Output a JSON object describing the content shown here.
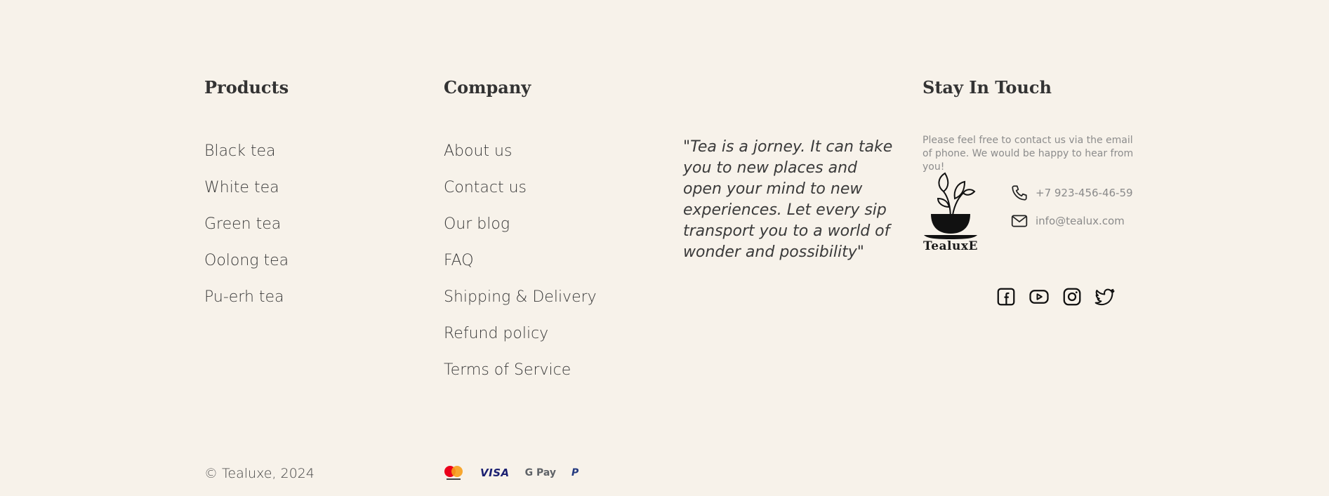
{
  "products": {
    "title": "Products",
    "items": [
      "Black tea",
      "White tea",
      "Green tea",
      "Oolong tea",
      "Pu-erh tea"
    ]
  },
  "company": {
    "title": "Company",
    "items": [
      "About us",
      "Contact us",
      "Our blog",
      "FAQ",
      "Shipping & Delivery",
      "Refund policy",
      "Terms of Service"
    ]
  },
  "quote": "\"Tea is a jorney. It can take you to new places and open your mind to new experiences. Let every sip transport you to a world of wonder and possibility\"",
  "touch": {
    "title": "Stay In Touch",
    "text": "Please feel free to contact us via the email of phone. We would be happy to hear from you!",
    "logo_text": "TealuxE",
    "phone": "+7 923-456-46-59",
    "email": "info@tealux.com",
    "social": [
      "facebook-icon",
      "youtube-icon",
      "instagram-icon",
      "twitter-icon"
    ]
  },
  "footer": {
    "copyright": "© Tealuxe, 2024",
    "payments": [
      "mastercard-icon",
      "VISA",
      "G Pay",
      "P"
    ]
  },
  "colors": {
    "background": "#f7f2ea",
    "text": "#3a3a3a",
    "muted": "#8c8c8c"
  }
}
